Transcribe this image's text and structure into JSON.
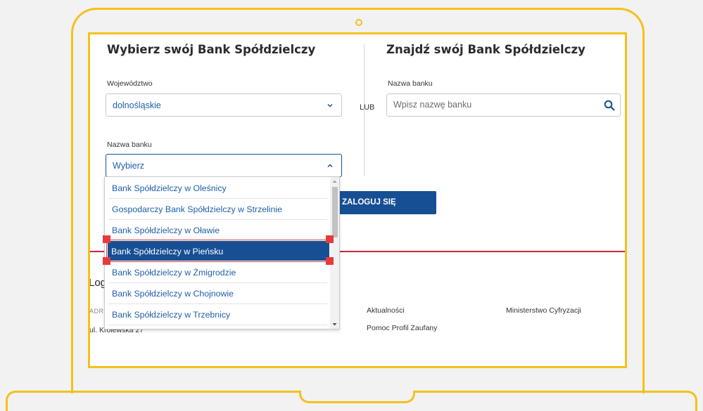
{
  "left_panel": {
    "title": "Wybierz swój Bank Spółdzielczy",
    "voivodeship_label": "Województwo",
    "voivodeship_value": "dolnośląskie",
    "bank_label": "Nazwa banku",
    "bank_value": "Wybierz"
  },
  "separator": "LUB",
  "right_panel": {
    "title": "Znajdź swój Bank Spółdzielczy",
    "bank_label": "Nazwa banku",
    "search_placeholder": "Wpisz nazwę banku"
  },
  "login_button": "ZALOGUJ SIĘ",
  "dropdown": {
    "options": [
      "Bank Spółdzielczy w Oleśnicy",
      "Gospodarczy Bank Spółdzielczy w Strzelinie",
      "Bank Spółdzielczy w Oławie",
      "Bank Spółdzielczy w Pieńsku",
      "Bank Spółdzielczy w Żmigrodzie",
      "Bank Spółdzielczy w Chojnowie",
      "Bank Spółdzielczy w Trzebnicy"
    ],
    "selected_index": 3
  },
  "footer": {
    "logo_partial": "Log",
    "address_partial": "ADRE",
    "street_partial": "ul. Królewska 27",
    "links": [
      "Aktualności",
      "Pomoc Profil Zaufany",
      "Ministerstwo Cyfryzacji"
    ]
  },
  "colors": {
    "accent_yellow": "#f5c01c",
    "primary_blue": "#174f95",
    "link_blue": "#1f5fa8",
    "highlight_red": "#e63b3b",
    "footer_red": "#c4283b"
  }
}
